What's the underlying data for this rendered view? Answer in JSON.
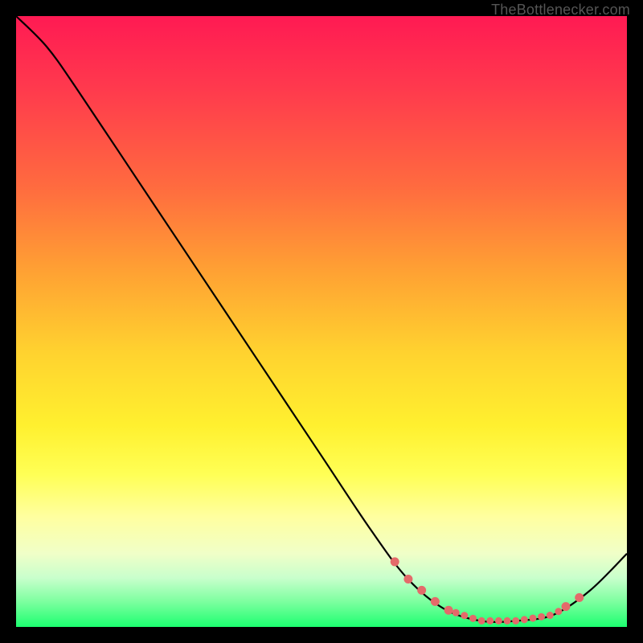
{
  "attribution": "TheBottlenecker.com",
  "chart_data": {
    "type": "line",
    "title": "",
    "xlabel": "",
    "ylabel": "",
    "x_range": [
      0,
      100
    ],
    "y_range": [
      0,
      100
    ],
    "series": [
      {
        "name": "bottleneck-curve",
        "points": [
          {
            "x": 0,
            "y": 100
          },
          {
            "x": 5,
            "y": 95
          },
          {
            "x": 10,
            "y": 88
          },
          {
            "x": 20,
            "y": 73
          },
          {
            "x": 30,
            "y": 58
          },
          {
            "x": 40,
            "y": 43
          },
          {
            "x": 50,
            "y": 28
          },
          {
            "x": 58,
            "y": 16
          },
          {
            "x": 64,
            "y": 8
          },
          {
            "x": 70,
            "y": 3
          },
          {
            "x": 76,
            "y": 1
          },
          {
            "x": 82,
            "y": 1
          },
          {
            "x": 88,
            "y": 2
          },
          {
            "x": 94,
            "y": 6
          },
          {
            "x": 100,
            "y": 12
          }
        ]
      }
    ],
    "dotted_segments": [
      {
        "from_x": 62,
        "to_x": 72
      },
      {
        "from_x": 72,
        "to_x": 90
      },
      {
        "from_x": 90,
        "to_x": 94
      }
    ],
    "colors": {
      "curve": "#000000",
      "dots": "#e46a6a",
      "gradient_top": "#ff1a53",
      "gradient_mid": "#fff02f",
      "gradient_bottom": "#1cff70",
      "background": "#000000"
    }
  }
}
